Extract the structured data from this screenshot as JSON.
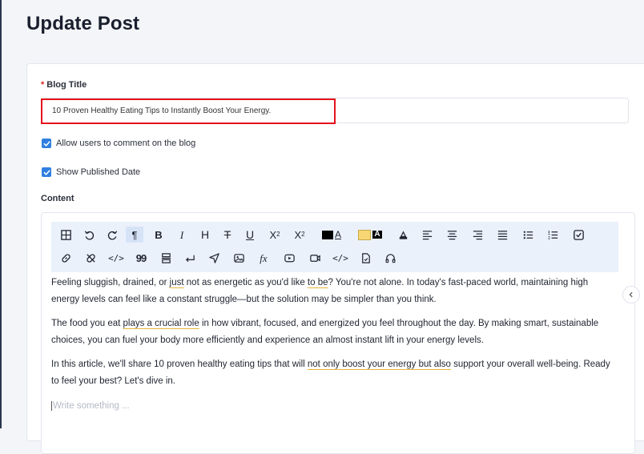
{
  "page": {
    "title": "Update Post"
  },
  "form": {
    "blog_title_label": "Blog Title",
    "required_mark": "*",
    "blog_title_value": "10 Proven Healthy Eating Tips to Instantly Boost Your Energy.",
    "allow_comments_label": "Allow users to comment on the blog",
    "allow_comments_checked": true,
    "show_date_label": "Show Published Date",
    "show_date_checked": true,
    "content_label": "Content"
  },
  "toolbar": {
    "bold": "B",
    "italic": "I",
    "heading": "H",
    "strike": "T",
    "underline": "U",
    "sub_base": "X",
    "sub_mark": "2",
    "sup_base": "X",
    "sup_mark": "2",
    "text_color_glyph": "A",
    "bg_color_glyph": "A",
    "text_color": "#000000",
    "bg_color": "#f7d774",
    "link_glyph": "",
    "formula_glyph": "fx",
    "paragraph_glyph": "¶",
    "quote_glyph": "99",
    "code_glyph": "</>"
  },
  "content": {
    "p1": {
      "a": "Feeling sluggish, drained, or ",
      "u1": "just",
      "b": " not as energetic as you'd like ",
      "u2": "to be",
      "c": "? You're not alone. In today's fast-paced world, maintaining high energy levels can feel like a constant struggle—but the solution may be simpler than you think."
    },
    "p2": {
      "a": "The food you eat ",
      "u1": "plays a crucial role",
      "b": " in how vibrant, focused, and energized you feel throughout the day. By making smart, sustainable choices, you can fuel your body more efficiently and experience an almost instant lift in your energy levels."
    },
    "p3": {
      "a": "In this article, we'll share 10 proven healthy eating tips that will ",
      "u1": "not only boost your energy but also",
      "b": " support your overall well-being. Ready to feel your best? Let's dive in."
    },
    "placeholder": "Write something ..."
  },
  "colors": {
    "accent": "#2f7fe0",
    "highlight": "#e5121c",
    "toolbar_bg": "#eaf1fb"
  }
}
